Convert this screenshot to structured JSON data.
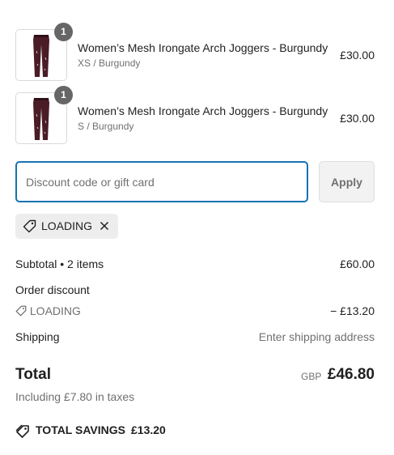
{
  "line_items": [
    {
      "quantity": "1",
      "title": "Women’s Mesh Irongate Arch Joggers - Burgundy",
      "variant": "XS / Burgundy",
      "price": "£30.00",
      "image_icon": "burgundy-joggers-thumbnail"
    },
    {
      "quantity": "1",
      "title": "Women’s Mesh Irongate Arch Joggers - Burgundy",
      "variant": "S / Burgundy",
      "price": "£30.00",
      "image_icon": "burgundy-joggers-thumbnail"
    }
  ],
  "discount": {
    "placeholder": "Discount code or gift card",
    "value": "",
    "apply_label": "Apply",
    "applied_code": "LOADING"
  },
  "summary": {
    "subtotal_label": "Subtotal • 2 items",
    "subtotal_value": "£60.00",
    "order_discount_label": "Order discount",
    "discount_code": "LOADING",
    "discount_value": "− £13.20",
    "shipping_label": "Shipping",
    "shipping_value": "Enter shipping address",
    "total_label": "Total",
    "currency": "GBP",
    "total_value": "£46.80",
    "tax_note": "Including £7.80 in taxes",
    "savings_label": "TOTAL SAVINGS",
    "savings_value": "£13.20"
  },
  "colors": {
    "focus_border": "#1773b0",
    "badge": "#666666",
    "muted_text": "#707070",
    "chip_bg": "#ededed",
    "product": "#4a1c26"
  }
}
